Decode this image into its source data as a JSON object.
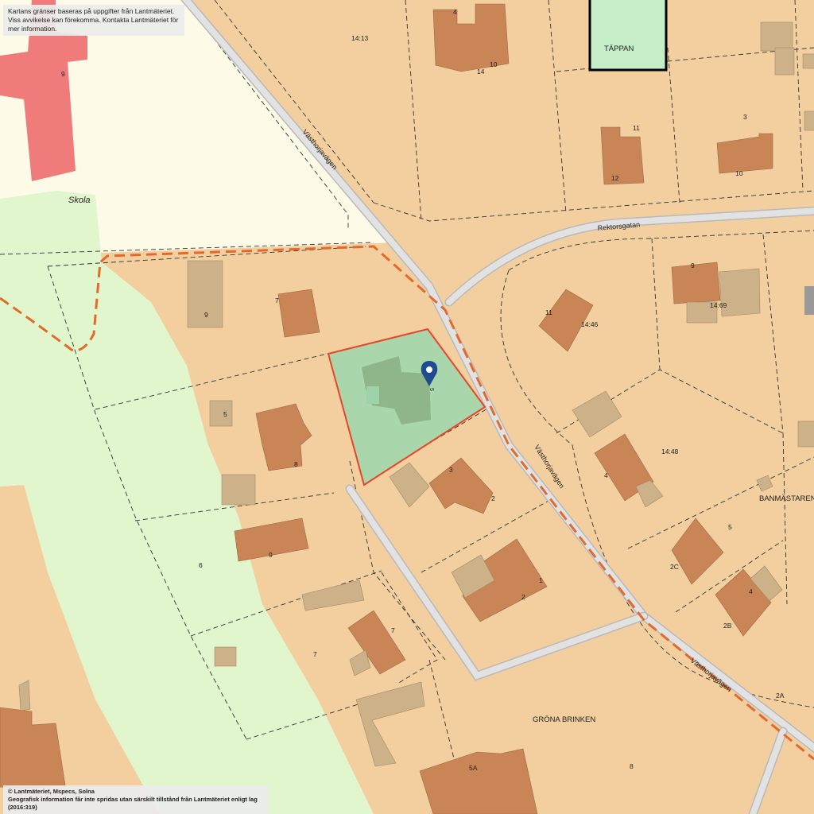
{
  "map": {
    "colors": {
      "residential": "#f3cfa0",
      "park": "#e2f6cd",
      "school_area": "#fdfbe8",
      "road": "#d8d8d8",
      "building": "#c98555",
      "outbuilding": "#cdb188",
      "school_building": "#ef7b7a",
      "selected_parcel": "#a9d6aa",
      "selected_parcel_border": "#e8462a",
      "trail": "#e26a2c",
      "tappan_fill": "#c5eec8",
      "marker": "#1d4d8f"
    },
    "attribution_top": {
      "line1": "Kartans gränser baseras på uppgifter från Lantmäteriet.",
      "line2": "Viss avvikelse kan förekomma. Kontakta Lantmäteriet för mer information."
    },
    "attribution_bottom": {
      "line1": "© Lantmäteriet, Mspecs, Solna",
      "line2": "Geografisk information får inte spridas utan särskilt tillstånd från Lantmäteriet enligt lag (2016:319)"
    },
    "place_labels": {
      "skola": "Skola",
      "tappan": "TÄPPAN",
      "banmastaren": "BANMÄSTAREN",
      "grona_brinken": "GRÖNA BRINKEN"
    },
    "road_labels": {
      "vasthorja_1": "Västhorjavägen",
      "vasthorja_2": "Västhorjavägen",
      "vasthorja_3": "Västhorjavägen",
      "rektorsgatan": "Rektorsgatan"
    },
    "parcel_labels": {
      "p14_13": "14:13",
      "p14_46": "14:46",
      "p14_48": "14:48",
      "p14_69": "14:69"
    },
    "house_numbers": {
      "n4_top": "4",
      "n14_top": "14",
      "n10_top": "10",
      "n11": "11",
      "n12": "12",
      "n3_right": "3",
      "n10_right": "10",
      "n9_school": "9",
      "n9_left": "9",
      "n7_left": "7",
      "n5_left": "5",
      "n8_left": "8",
      "n6": "6",
      "n9_lower": "9",
      "n7_low_a": "7",
      "n7_low_b": "7",
      "n3_mid": "3",
      "n2_mid": "2",
      "n1": "1",
      "n2_low": "2",
      "n9_right": "9",
      "n11_right": "11",
      "n4_right": "4",
      "n5_right": "5",
      "n2c": "2C",
      "n4_far": "4",
      "n2b": "2B",
      "n2a": "2A",
      "n5a": "5A",
      "n8_bottom": "8",
      "n5_sel": "5"
    }
  }
}
